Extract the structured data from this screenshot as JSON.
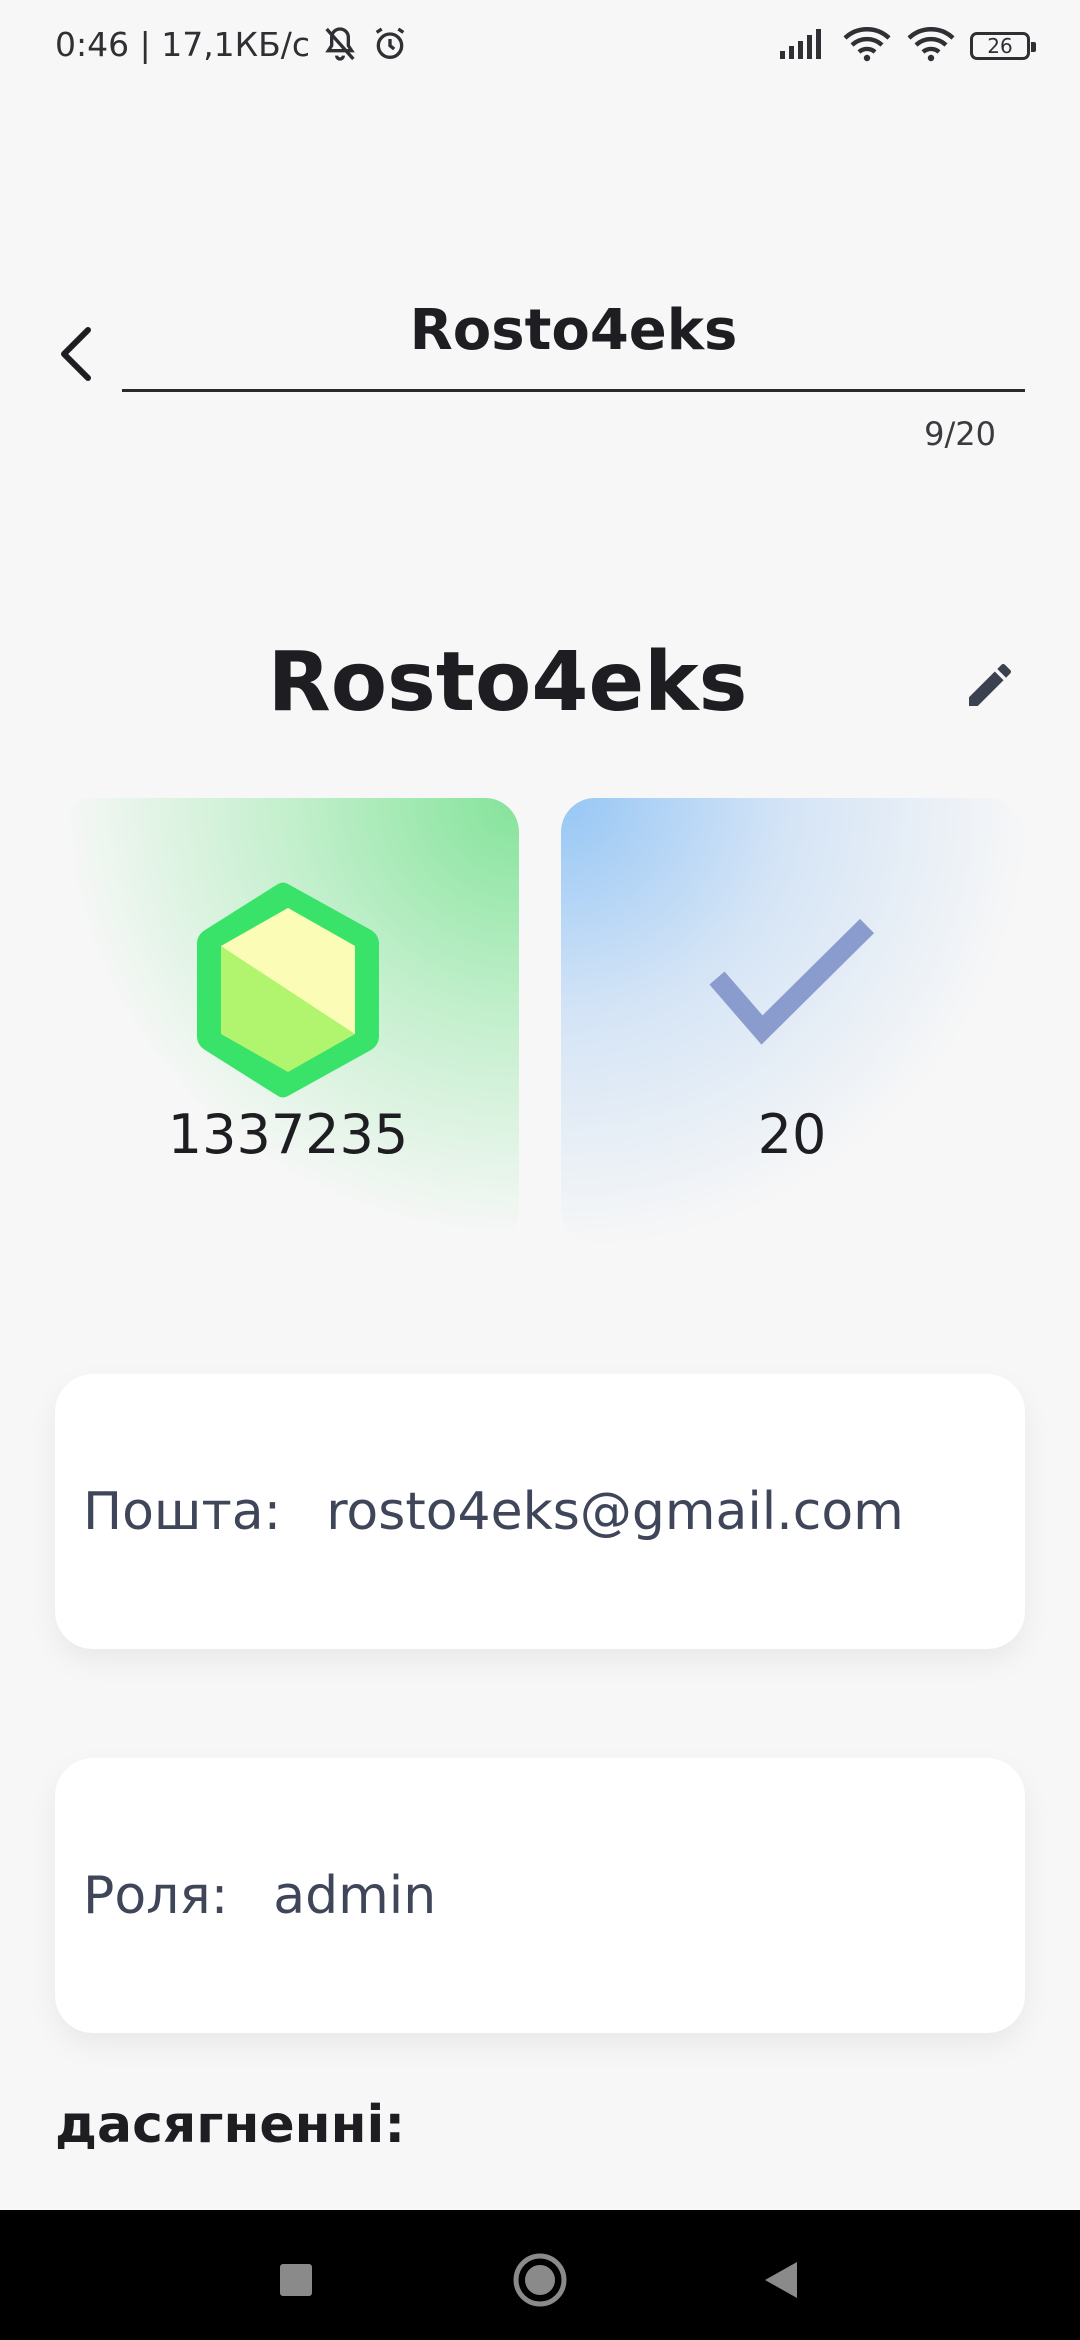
{
  "status_bar": {
    "time_speed": "0:46 | 17,1КБ/с",
    "battery": "26",
    "icons": [
      "notifications-muted-icon",
      "alarm-icon",
      "signal-icon",
      "wifi-icon",
      "wifi-icon",
      "battery-icon"
    ]
  },
  "header": {
    "title": "Rosto4eks",
    "counter": "9/20"
  },
  "profile": {
    "name": "Rosto4eks"
  },
  "stats": {
    "gems": "1337235",
    "completed": "20"
  },
  "info": {
    "email_label": "Пошта:",
    "email_value": "rosto4eks@gmail.com",
    "role_label": "Роля:",
    "role_value": "admin"
  },
  "achievements_label": "дасягненні:",
  "colors": {
    "background": "#f7f7f7",
    "green_card": "#7ee296",
    "blue_card": "#91c4f5",
    "gem_outer": "#39e36a",
    "check": "#8a9ccd",
    "info_text": "#40465a"
  }
}
